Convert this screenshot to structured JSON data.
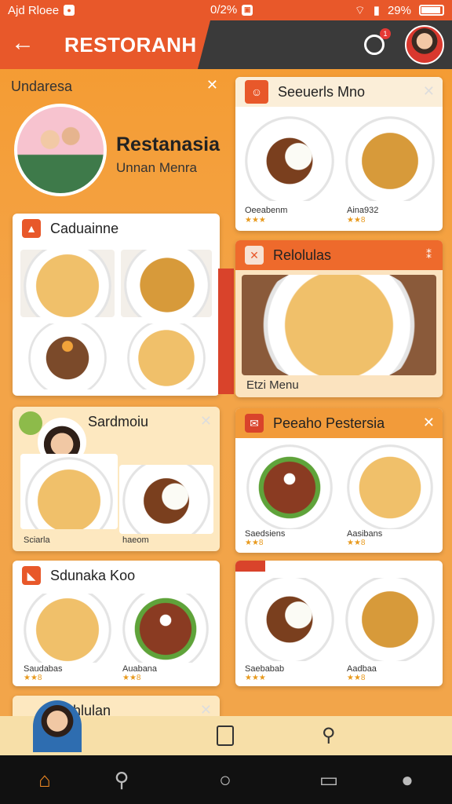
{
  "status": {
    "carrier": "Ajd Rloee",
    "mid_percent": "0/2%",
    "battery": "29%"
  },
  "appbar": {
    "title": "RESTORANH",
    "badge": "1"
  },
  "profile": {
    "header": "Undaresa",
    "name": "Restanasia",
    "subtitle": "Unnan Menra"
  },
  "left_cards": [
    {
      "title": "Caduainne"
    },
    {
      "title": "Sardmoiu",
      "labels": [
        "Sciarla",
        "haeom"
      ]
    },
    {
      "title": "Sdunaka Koo",
      "labels": [
        "Saudabas",
        "Auabana"
      ],
      "ratings": [
        "★★8",
        "★★8"
      ]
    },
    {
      "title": "Fehlulan"
    }
  ],
  "right_cards": [
    {
      "title": "Seeuerls Mno",
      "labels": [
        "Oeeabenm",
        "Aina932"
      ],
      "ratings": [
        "★★★",
        "★★8"
      ]
    },
    {
      "title": "Relolulas",
      "footer": "Etzi Menu",
      "header_right": "⁑"
    },
    {
      "title": "Peeaho Pestersia",
      "labels": [
        "Saedsiens",
        "Aasibans"
      ],
      "ratings": [
        "★★8",
        "★★8"
      ]
    },
    {
      "labels": [
        "Saebabab",
        "Aadbaa"
      ],
      "ratings": [
        "★★★",
        "★★8"
      ]
    }
  ],
  "icons": {
    "back": "arrow-left-icon",
    "chat": "chat-icon",
    "home": "home-icon",
    "search": "search-icon",
    "circle": "circle-icon",
    "message": "message-icon",
    "person": "person-icon",
    "map": "map-icon",
    "tool": "wrench-icon"
  }
}
